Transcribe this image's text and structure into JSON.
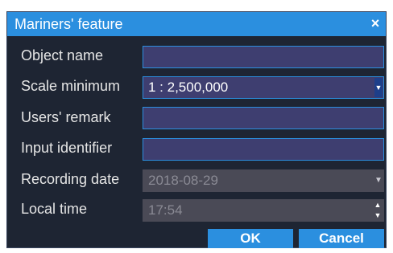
{
  "dialog": {
    "title": "Mariners' feature",
    "close_glyph": "×"
  },
  "fields": {
    "object_name": {
      "label": "Object name",
      "value": ""
    },
    "scale_minimum": {
      "label": "Scale minimum",
      "value": "1 : 2,500,000"
    },
    "users_remark": {
      "label": "Users' remark",
      "value": ""
    },
    "input_identifier": {
      "label": "Input identifier",
      "value": ""
    },
    "recording_date": {
      "label": "Recording date",
      "value": "2018-08-29"
    },
    "local_time": {
      "label": "Local time",
      "value": "17:54"
    }
  },
  "buttons": {
    "ok": "OK",
    "cancel": "Cancel"
  },
  "icons": {
    "dropdown": "▼",
    "spin_up": "▲",
    "spin_down": "▼"
  },
  "colors": {
    "titlebar": "#2b8fdf",
    "dialog_bg": "#1e2533",
    "field_bg": "#3e3e70",
    "field_border": "#2b8fdf",
    "disabled_field_bg": "#4a4a56",
    "button_bg": "#2b8fdf"
  }
}
